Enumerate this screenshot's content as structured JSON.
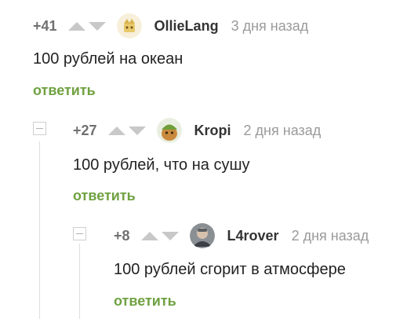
{
  "comments": [
    {
      "rating": "+41",
      "author": "OllieLang",
      "time": "3 дня назад",
      "text": "100 рублей на океан",
      "reply": "ответить"
    },
    {
      "rating": "+27",
      "author": "Kropi",
      "time": "2 дня назад",
      "text": "100 рублей, что на сушу",
      "reply": "ответить"
    },
    {
      "rating": "+8",
      "author": "L4rover",
      "time": "2 дня назад",
      "text": "100 рублей сгорит в атмосфере",
      "reply": "ответить"
    }
  ],
  "colors": {
    "reply": "#6fa141",
    "rating": "#707070",
    "time": "#9a9a9a",
    "vote_arrows": "#c8c8c8"
  }
}
